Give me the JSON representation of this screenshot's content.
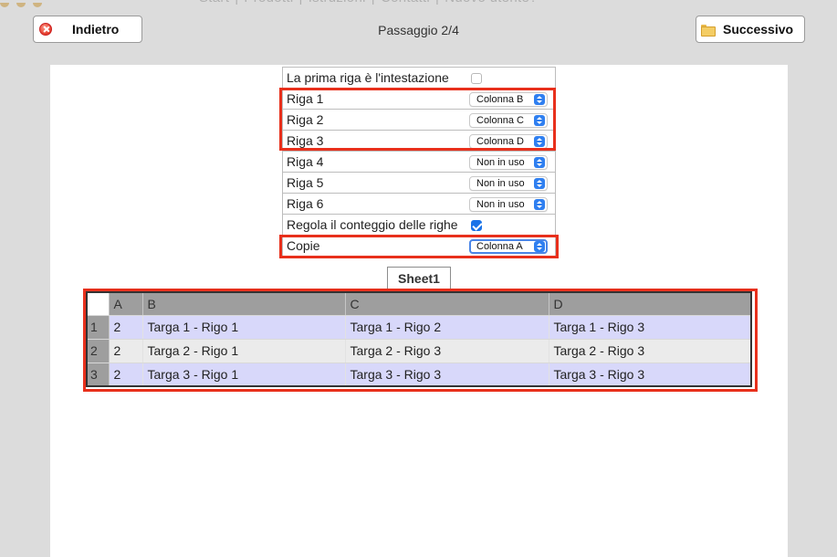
{
  "topnav": {
    "links": [
      "Start",
      "|",
      "Prodotti",
      "|",
      "Istruzioni",
      "|",
      "Contatti",
      "|",
      "Nuovo utente?"
    ]
  },
  "toolbar": {
    "back_label": "Indietro",
    "next_label": "Successivo",
    "step_text": "Passaggio 2/4"
  },
  "form": {
    "header_row": {
      "label": "La prima riga è l'intestazione",
      "checked": false
    },
    "rows": [
      {
        "label": "Riga 1",
        "value": "Colonna B"
      },
      {
        "label": "Riga 2",
        "value": "Colonna C"
      },
      {
        "label": "Riga 3",
        "value": "Colonna D"
      },
      {
        "label": "Riga 4",
        "value": "Non in uso"
      },
      {
        "label": "Riga 5",
        "value": "Non in uso"
      },
      {
        "label": "Riga 6",
        "value": "Non in uso"
      }
    ],
    "adjust_row": {
      "label": "Regola il conteggio delle righe",
      "checked": true
    },
    "copies_row": {
      "label": "Copie",
      "value": "Colonna A"
    }
  },
  "sheet": {
    "tab_label": "Sheet1",
    "columns": [
      "A",
      "B",
      "C",
      "D"
    ],
    "rows": [
      {
        "num": "1",
        "cells": [
          "2",
          "Targa 1 - Rigo 1",
          "Targa 1 - Rigo 2",
          "Targa 1 - Rigo 3"
        ]
      },
      {
        "num": "2",
        "cells": [
          "2",
          "Targa 2 - Rigo 1",
          "Targa 2 - Rigo 3",
          "Targa 2 - Rigo 3"
        ]
      },
      {
        "num": "3",
        "cells": [
          "2",
          "Targa 3 - Rigo 1",
          "Targa 3 - Rigo 3",
          "Targa 3 - Rigo 3"
        ]
      }
    ]
  },
  "colors": {
    "highlight": "#e8301c",
    "row_odd": "#d8d8fa",
    "row_even": "#ebebeb",
    "header_gray": "#9e9e9e",
    "select_accent": "#2f7ff0"
  },
  "icons": {
    "back": "close-circle-red-icon",
    "next": "folder-icon",
    "select_arrow": "up-down-chevron-icon"
  }
}
